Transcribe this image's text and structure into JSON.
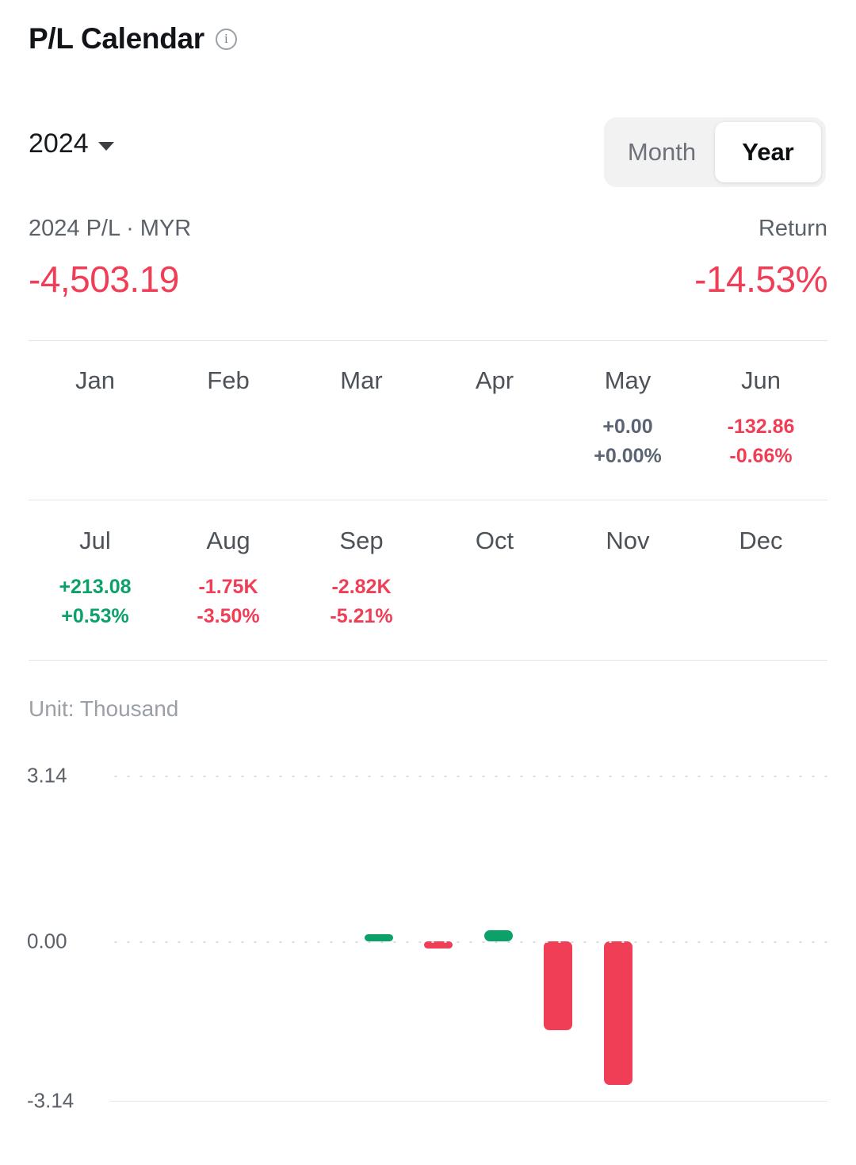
{
  "header": {
    "title": "P/L Calendar",
    "info_icon": "info-icon"
  },
  "controls": {
    "year": "2024",
    "caret_icon": "chevron-down-icon",
    "toggle": {
      "options": [
        "Month",
        "Year"
      ],
      "selected": "Year"
    }
  },
  "summary": {
    "pl_label": "2024 P/L · MYR",
    "pl_value": "-4,503.19",
    "return_label": "Return",
    "return_value": "-14.53%"
  },
  "months": [
    {
      "name": "Jan",
      "pl": "",
      "pct": "",
      "state": "none"
    },
    {
      "name": "Feb",
      "pl": "",
      "pct": "",
      "state": "none"
    },
    {
      "name": "Mar",
      "pl": "",
      "pct": "",
      "state": "none"
    },
    {
      "name": "Apr",
      "pl": "",
      "pct": "",
      "state": "none"
    },
    {
      "name": "May",
      "pl": "+0.00",
      "pct": "+0.00%",
      "state": "flat"
    },
    {
      "name": "Jun",
      "pl": "-132.86",
      "pct": "-0.66%",
      "state": "neg"
    },
    {
      "name": "Jul",
      "pl": "+213.08",
      "pct": "+0.53%",
      "state": "pos"
    },
    {
      "name": "Aug",
      "pl": "-1.75K",
      "pct": "-3.50%",
      "state": "neg"
    },
    {
      "name": "Sep",
      "pl": "-2.82K",
      "pct": "-5.21%",
      "state": "neg"
    },
    {
      "name": "Oct",
      "pl": "",
      "pct": "",
      "state": "none"
    },
    {
      "name": "Nov",
      "pl": "",
      "pct": "",
      "state": "none"
    },
    {
      "name": "Dec",
      "pl": "",
      "pct": "",
      "state": "none"
    }
  ],
  "chart_unit_label": "Unit: Thousand",
  "colors": {
    "positive": "#0ca169",
    "negative": "#ef3e56",
    "flat": "#5a6472",
    "grid": "#d9dbde"
  },
  "chart_data": {
    "type": "bar",
    "title": "",
    "subtitle": "Unit: Thousand",
    "xlabel": "",
    "ylabel": "",
    "unit": "Thousand",
    "currency": "MYR",
    "categories": [
      "Jan",
      "Feb",
      "Mar",
      "Apr",
      "May",
      "Jun",
      "Jul",
      "Aug",
      "Sep",
      "Oct",
      "Nov",
      "Dec"
    ],
    "values": [
      null,
      null,
      null,
      null,
      0.0,
      -0.13286,
      0.21308,
      -1.75,
      -2.82,
      null,
      null,
      null
    ],
    "ytick_labels": [
      "3.14",
      "0.00",
      "-3.14"
    ],
    "yticks": [
      3.14,
      0.0,
      -3.14
    ],
    "ylim": [
      -3.14,
      3.14
    ],
    "grid": true,
    "legend": "none",
    "bar_colors": {
      "positive": "#0ca169",
      "negative": "#ef3e56"
    }
  }
}
